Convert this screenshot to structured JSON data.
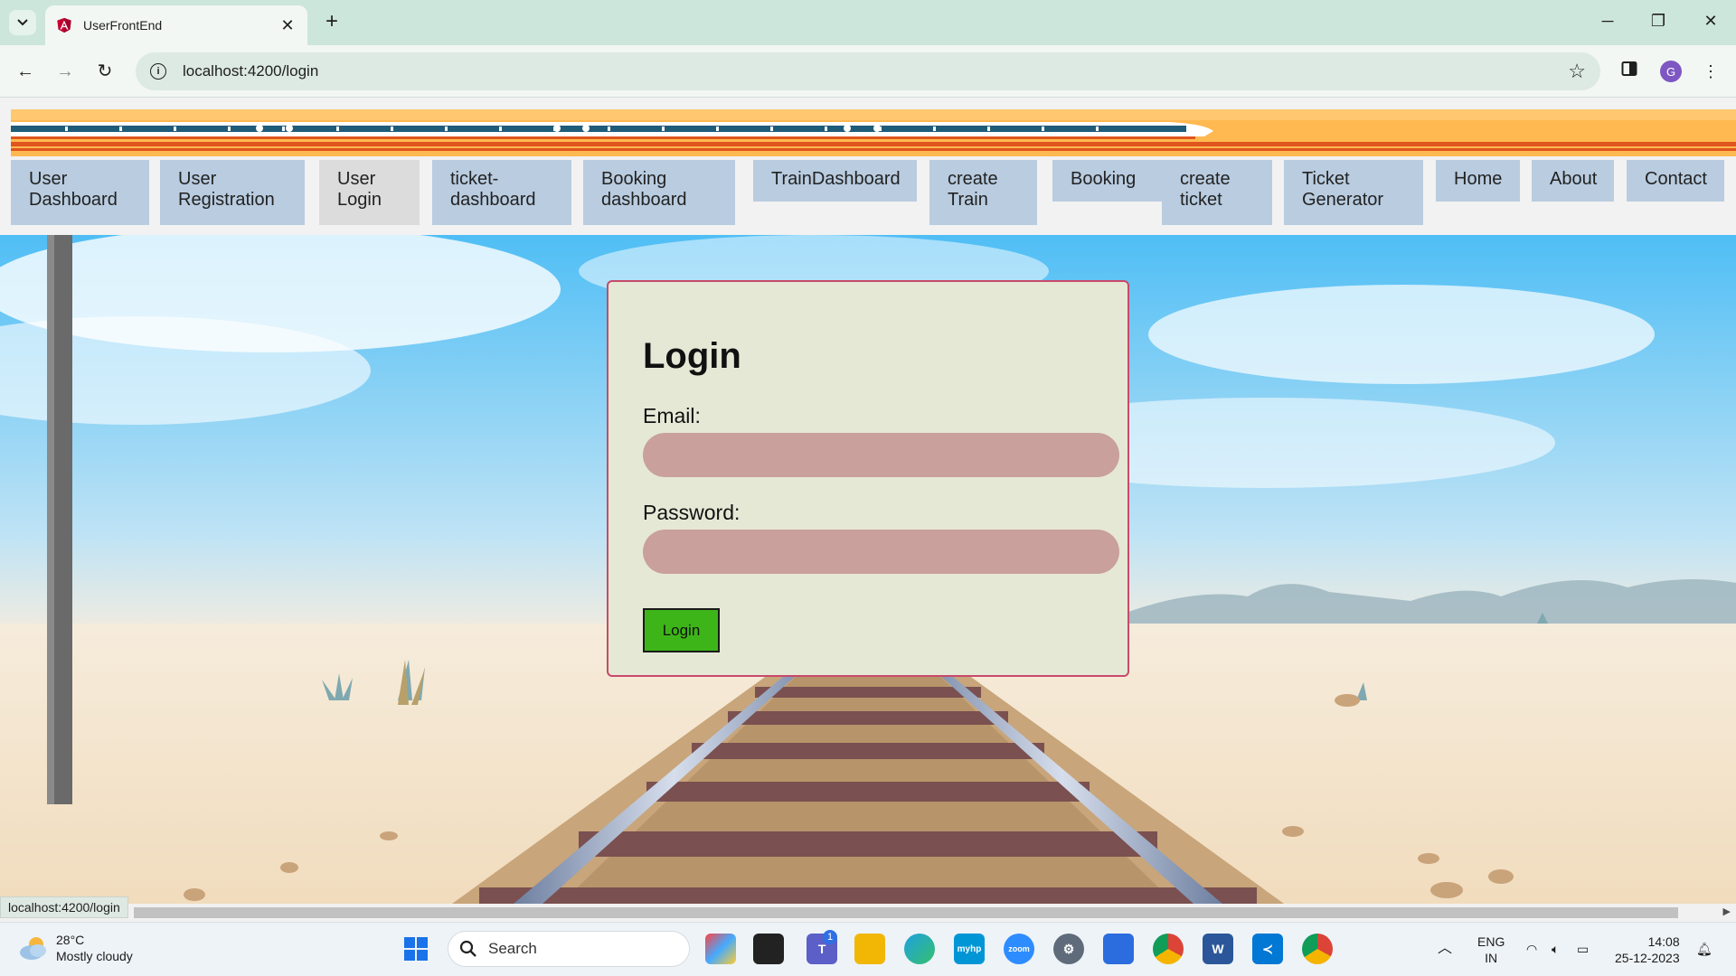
{
  "browser": {
    "tab_title": "UserFrontEnd",
    "url": "localhost:4200/login",
    "status_url": "localhost:4200/login",
    "profile_initial": "G"
  },
  "nav": {
    "items": [
      {
        "label": "User\nDashboard"
      },
      {
        "label": "User\nRegistration"
      },
      {
        "label": "User\nLogin"
      },
      {
        "label": "ticket-\ndashboard"
      },
      {
        "label": "Booking\ndashboard"
      },
      {
        "label": "TrainDashboard"
      },
      {
        "label": "create\nTrain"
      },
      {
        "label": "Booking"
      },
      {
        "label": "create\nticket"
      },
      {
        "label": "Ticket\nGenerator"
      },
      {
        "label": "Home"
      },
      {
        "label": "About"
      },
      {
        "label": "Contact"
      }
    ]
  },
  "login": {
    "title": "Login",
    "email_label": "Email:",
    "email_value": "",
    "password_label": "Password:",
    "password_value": "",
    "submit_label": "Login"
  },
  "taskbar": {
    "weather_temp": "28°C",
    "weather_desc": "Mostly cloudy",
    "search_label": "Search",
    "teams_badge": "1",
    "lang_top": "ENG",
    "lang_bottom": "IN",
    "time": "14:08",
    "date": "25-12-2023"
  },
  "colors": {
    "nav_bg": "#b9cce0",
    "card_bg": "#e6e8d6",
    "card_border": "#c84a6a",
    "input_bg": "#c9a09b",
    "button_bg": "#3db518"
  }
}
